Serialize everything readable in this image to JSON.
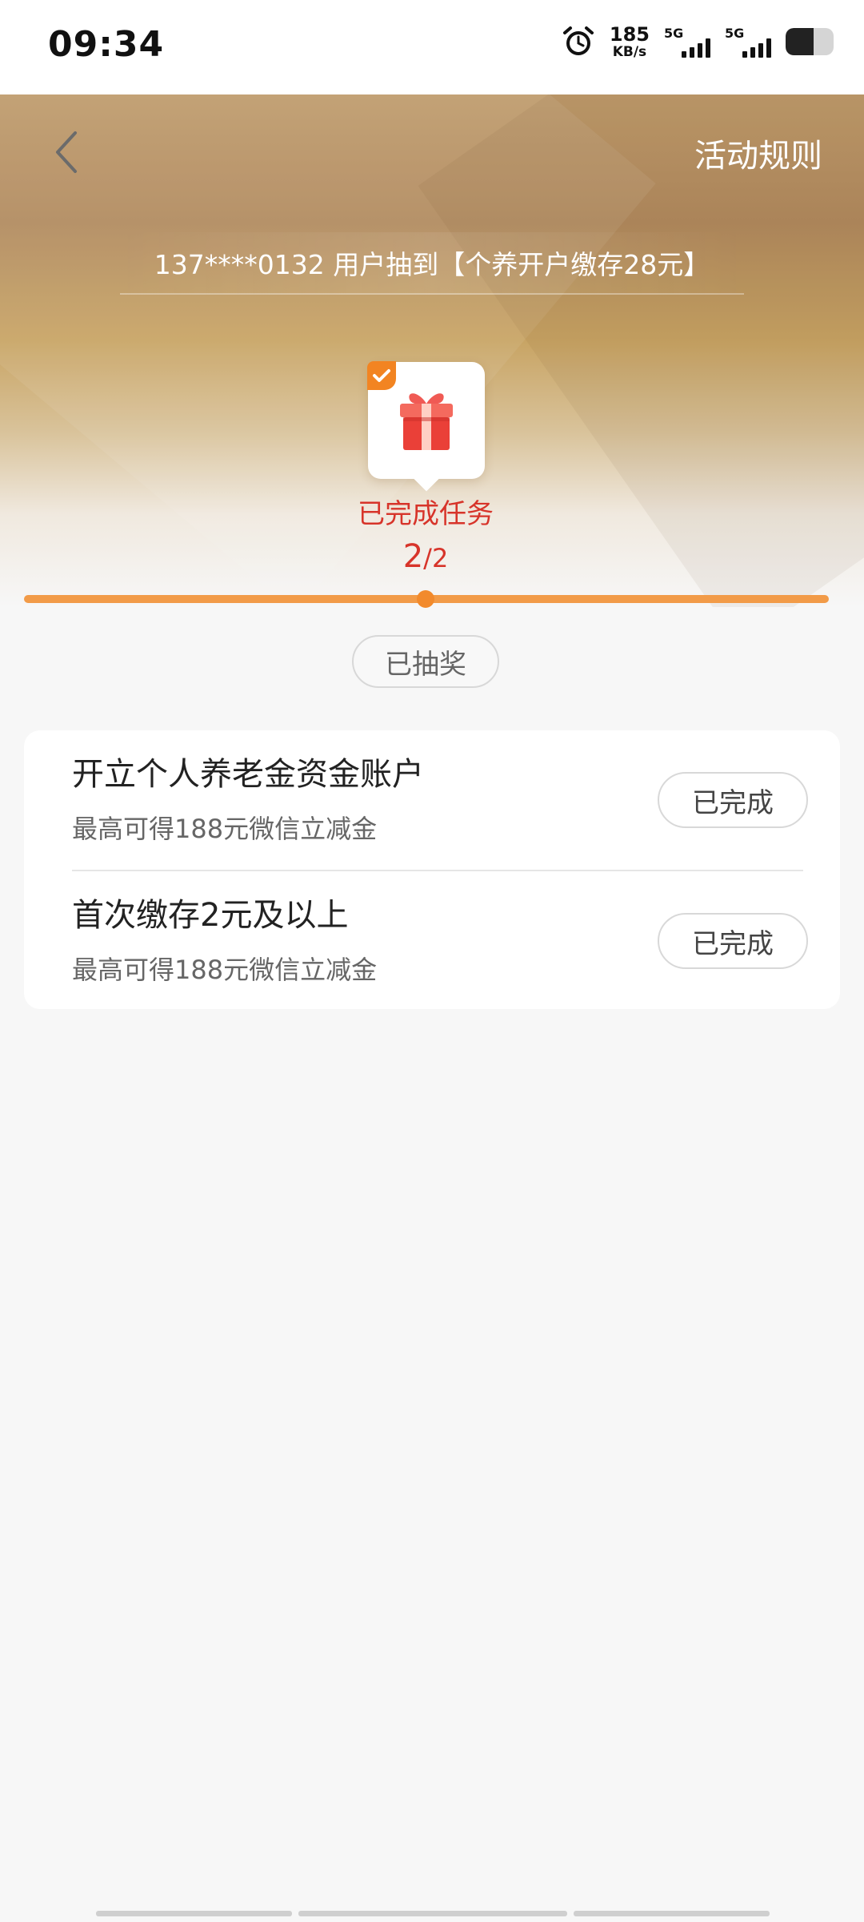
{
  "status_bar": {
    "time": "09:34",
    "net_speed_value": "185",
    "net_speed_unit": "KB/s",
    "sim1_label": "5G",
    "sim2_label": "5G",
    "icons": [
      "alarm-icon",
      "signal-icon",
      "signal-icon",
      "battery-icon"
    ]
  },
  "header": {
    "back_icon": "chevron-left-icon",
    "rules_label": "活动规则"
  },
  "ticker": {
    "text": "137****0132 用户抽到【个养开户缴存28元】"
  },
  "progress": {
    "badge_icon": "gift-icon",
    "status_label": "已完成任务",
    "completed": "2",
    "total_text": "/2",
    "completed_fraction": 1.0
  },
  "draw_button": {
    "label": "已抽奖"
  },
  "tasks": [
    {
      "title": "开立个人养老金资金账户",
      "subtitle": "最高可得188元微信立减金",
      "button": "已完成"
    },
    {
      "title": "首次缴存2元及以上",
      "subtitle": "最高可得188元微信立减金",
      "button": "已完成"
    }
  ],
  "colors": {
    "accent_orange": "#f28a2c",
    "task_red": "#d7342a",
    "hero_gold": "#c8a464"
  }
}
